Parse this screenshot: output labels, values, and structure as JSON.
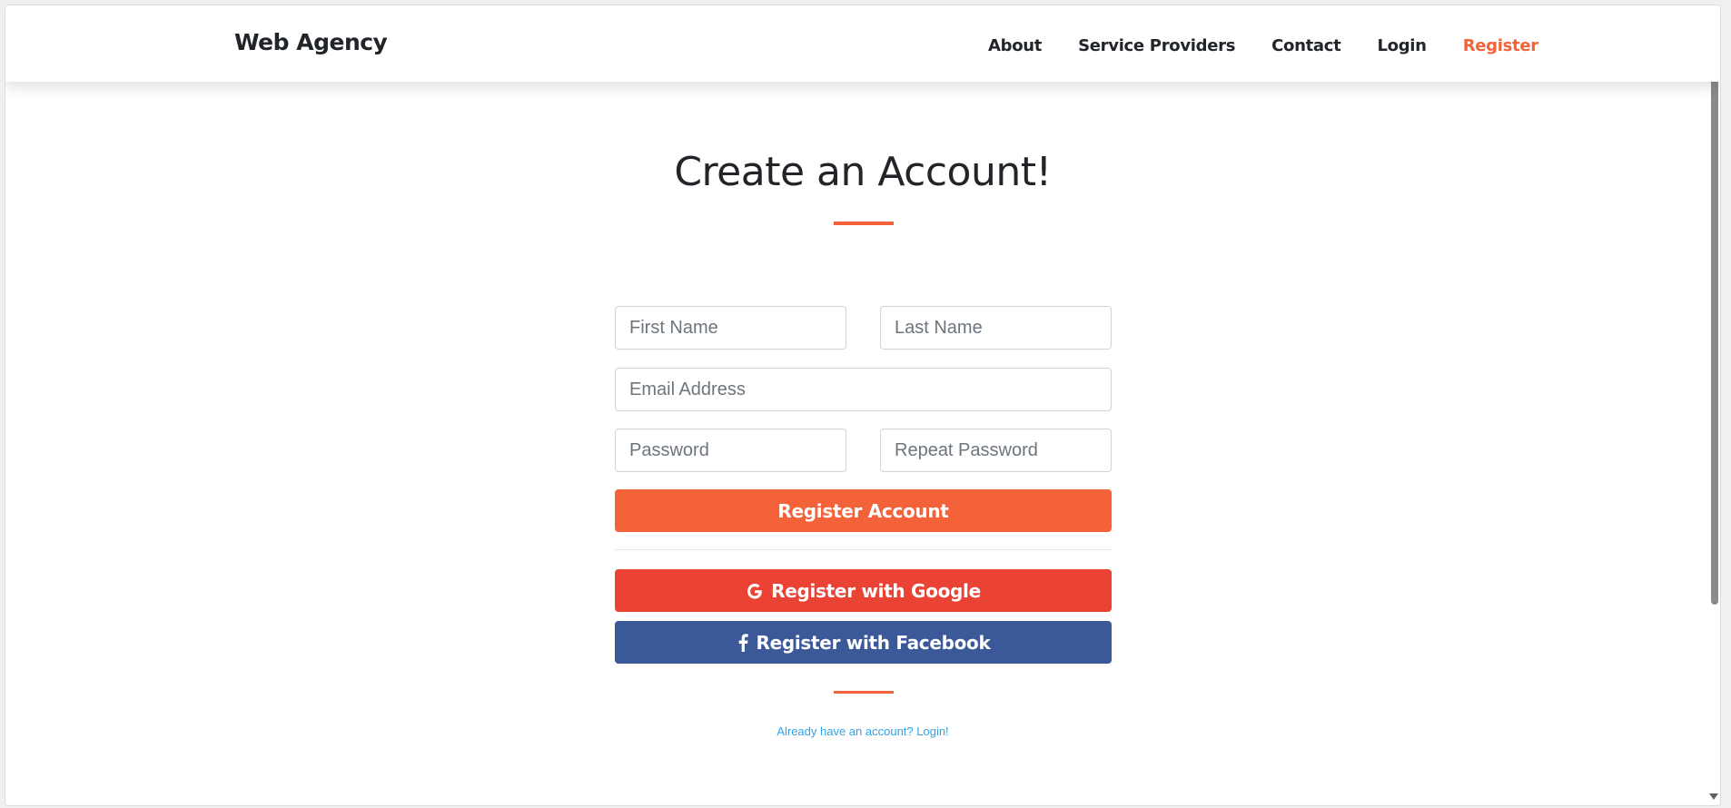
{
  "navbar": {
    "brand": "Web Agency",
    "links": [
      {
        "label": "About"
      },
      {
        "label": "Service Providers"
      },
      {
        "label": "Contact"
      },
      {
        "label": "Login"
      },
      {
        "label": "Register",
        "active": true
      }
    ]
  },
  "main": {
    "title": "Create an Account!",
    "form": {
      "first_name": {
        "value": "",
        "placeholder": "First Name"
      },
      "last_name": {
        "value": "",
        "placeholder": "Last Name"
      },
      "email": {
        "value": "",
        "placeholder": "Email Address"
      },
      "password": {
        "value": "",
        "placeholder": "Password"
      },
      "repeat_password": {
        "value": "",
        "placeholder": "Repeat Password"
      },
      "register_label": "Register Account",
      "google_label": "Register with Google",
      "facebook_label": "Register with Facebook"
    },
    "login_link": "Already have an account? Login!"
  },
  "colors": {
    "accent": "#f4623a",
    "google": "#ea4335",
    "facebook": "#3b5998",
    "link": "#2fa3e6",
    "text": "#212529"
  },
  "icons": {
    "google": "google-icon",
    "facebook": "facebook-icon"
  }
}
